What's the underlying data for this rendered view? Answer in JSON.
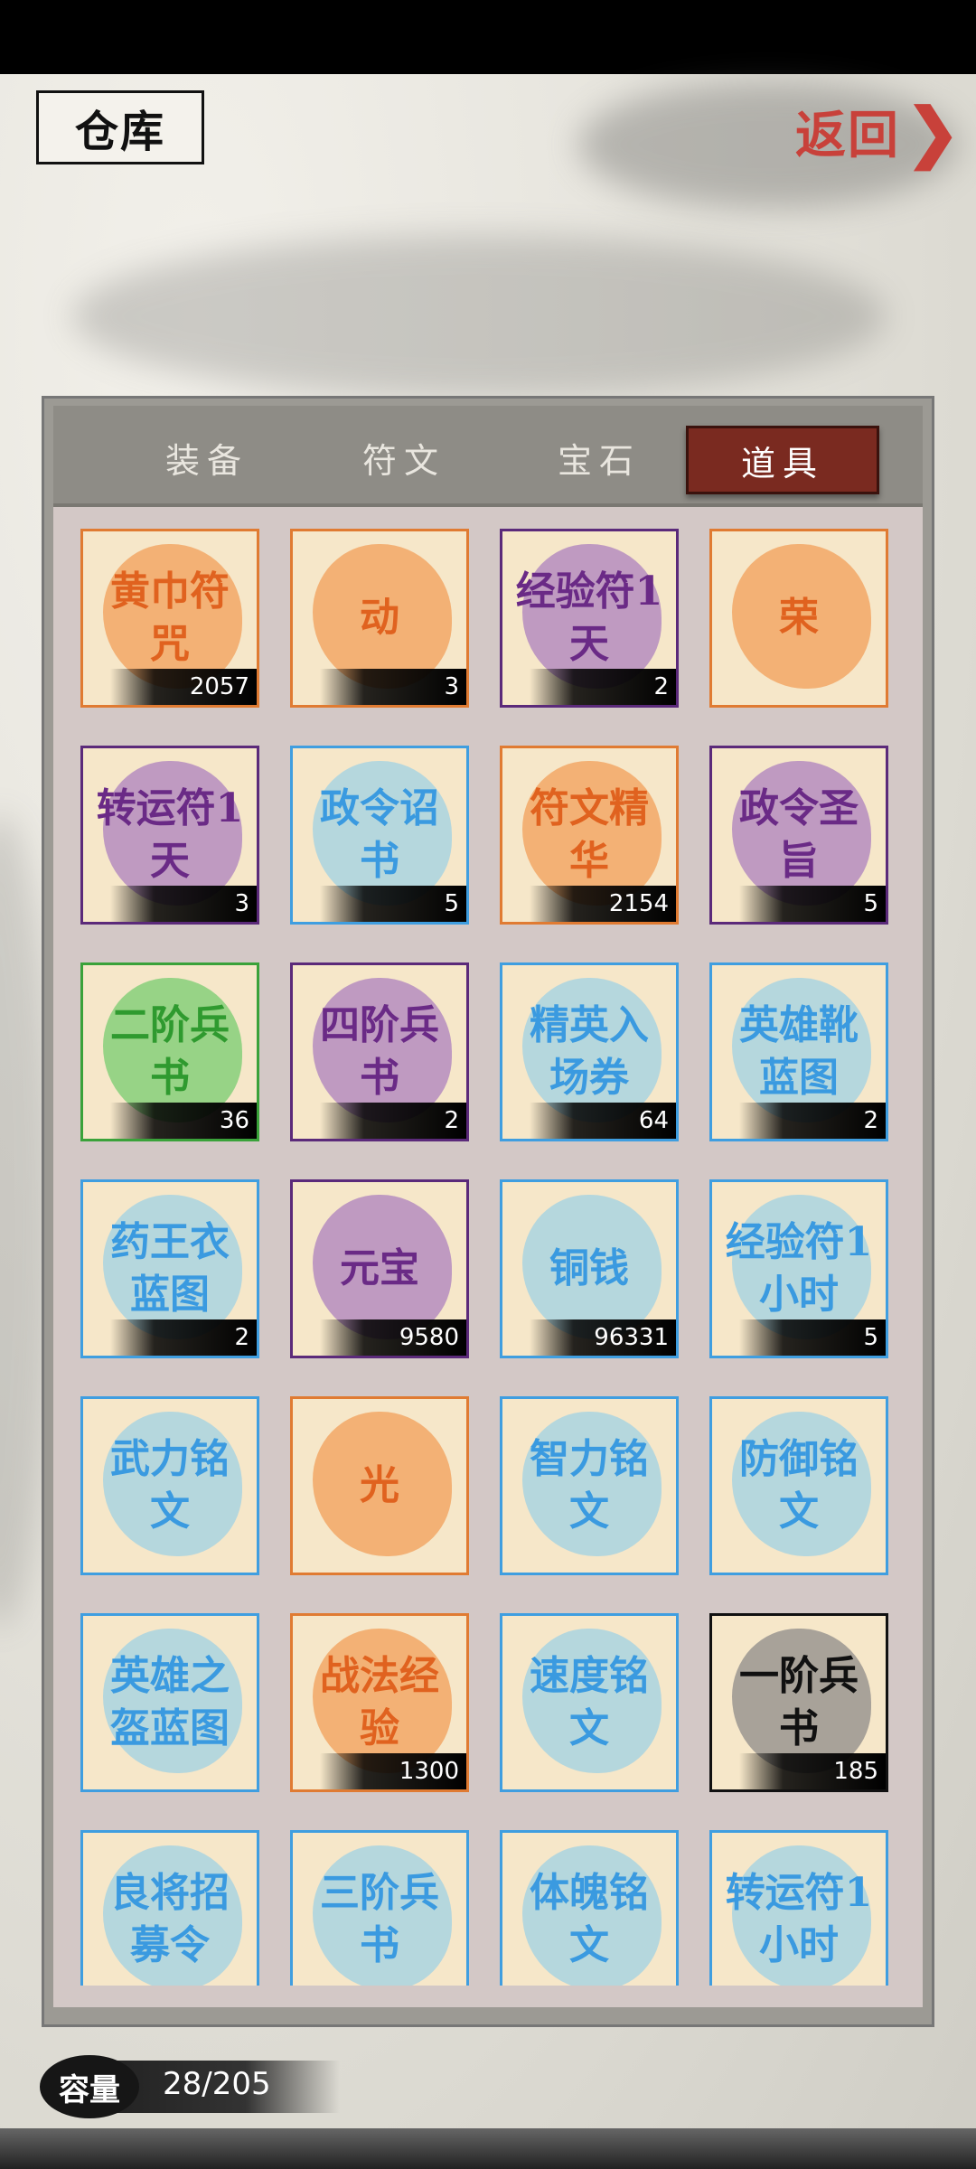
{
  "header": {
    "title": "仓库",
    "back_label": "返回",
    "back_chevron": "❯"
  },
  "tabs": [
    {
      "label": "装备",
      "active": false
    },
    {
      "label": "符文",
      "active": false
    },
    {
      "label": "宝石",
      "active": false
    },
    {
      "label": "道具",
      "active": true
    }
  ],
  "items": [
    {
      "name": "黄巾符咒",
      "qty": "2057",
      "rarity": "orange"
    },
    {
      "name": "动",
      "qty": "3",
      "rarity": "orange"
    },
    {
      "name": "经验符1天",
      "qty": "2",
      "rarity": "purple"
    },
    {
      "name": "荣",
      "qty": "",
      "rarity": "orange"
    },
    {
      "name": "转运符1天",
      "qty": "3",
      "rarity": "purple"
    },
    {
      "name": "政令诏书",
      "qty": "5",
      "rarity": "blue"
    },
    {
      "name": "符文精华",
      "qty": "2154",
      "rarity": "orange"
    },
    {
      "name": "政令圣旨",
      "qty": "5",
      "rarity": "purple"
    },
    {
      "name": "二阶兵书",
      "qty": "36",
      "rarity": "green"
    },
    {
      "name": "四阶兵书",
      "qty": "2",
      "rarity": "purple"
    },
    {
      "name": "精英入场券",
      "qty": "64",
      "rarity": "blue"
    },
    {
      "name": "英雄靴蓝图",
      "qty": "2",
      "rarity": "blue"
    },
    {
      "name": "药王衣蓝图",
      "qty": "2",
      "rarity": "blue"
    },
    {
      "name": "元宝",
      "qty": "9580",
      "rarity": "purple"
    },
    {
      "name": "铜钱",
      "qty": "96331",
      "rarity": "blue"
    },
    {
      "name": "经验符1小时",
      "qty": "5",
      "rarity": "blue"
    },
    {
      "name": "武力铭文",
      "qty": "",
      "rarity": "blue"
    },
    {
      "name": "光",
      "qty": "",
      "rarity": "orange"
    },
    {
      "name": "智力铭文",
      "qty": "",
      "rarity": "blue"
    },
    {
      "name": "防御铭文",
      "qty": "",
      "rarity": "blue"
    },
    {
      "name": "英雄之盔蓝图",
      "qty": "",
      "rarity": "blue"
    },
    {
      "name": "战法经验",
      "qty": "1300",
      "rarity": "orange"
    },
    {
      "name": "速度铭文",
      "qty": "",
      "rarity": "blue"
    },
    {
      "name": "一阶兵书",
      "qty": "185",
      "rarity": "black"
    },
    {
      "name": "良将招募令",
      "qty": "",
      "rarity": "blue"
    },
    {
      "name": "三阶兵书",
      "qty": "",
      "rarity": "blue"
    },
    {
      "name": "体魄铭文",
      "qty": "",
      "rarity": "blue"
    },
    {
      "name": "转运符1小时",
      "qty": "",
      "rarity": "blue"
    }
  ],
  "capacity": {
    "label": "容量",
    "value": "28/205"
  }
}
